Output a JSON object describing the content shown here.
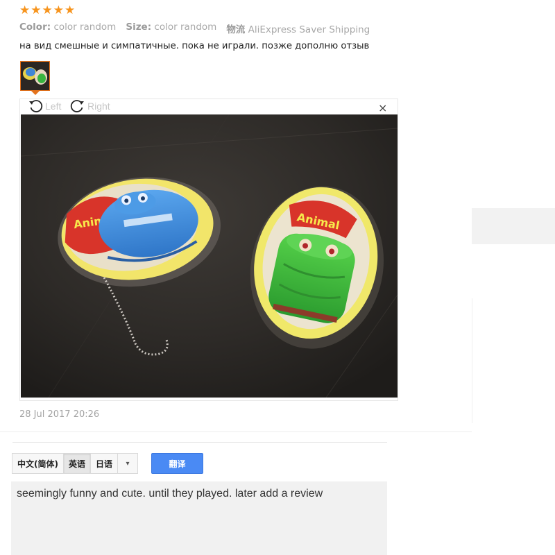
{
  "rating": {
    "stars": 5,
    "max": 5,
    "icon": "star-icon",
    "color": "#f7941d"
  },
  "attributes": [
    {
      "key": "Color:",
      "value": "color random"
    },
    {
      "key": "Size:",
      "value": "color random"
    },
    {
      "key": "物流",
      "value": "AliExpress Saver Shipping"
    }
  ],
  "review_text": "на вид смешные и симпатичные. пока не играли. позже дополню отзыв",
  "viewer": {
    "rotate_left_label": "Left",
    "rotate_right_label": "Right",
    "close_symbol": "×"
  },
  "review_date": "28 Jul 2017 20:26",
  "translator": {
    "languages": [
      "中文(简体)",
      "英语",
      "日语"
    ],
    "active_language": "英语",
    "dropdown_symbol": "▾",
    "translate_button": "翻译",
    "accent_color": "#4a8af4",
    "result_text": "seemingly funny and cute. until they played. later add a review"
  }
}
